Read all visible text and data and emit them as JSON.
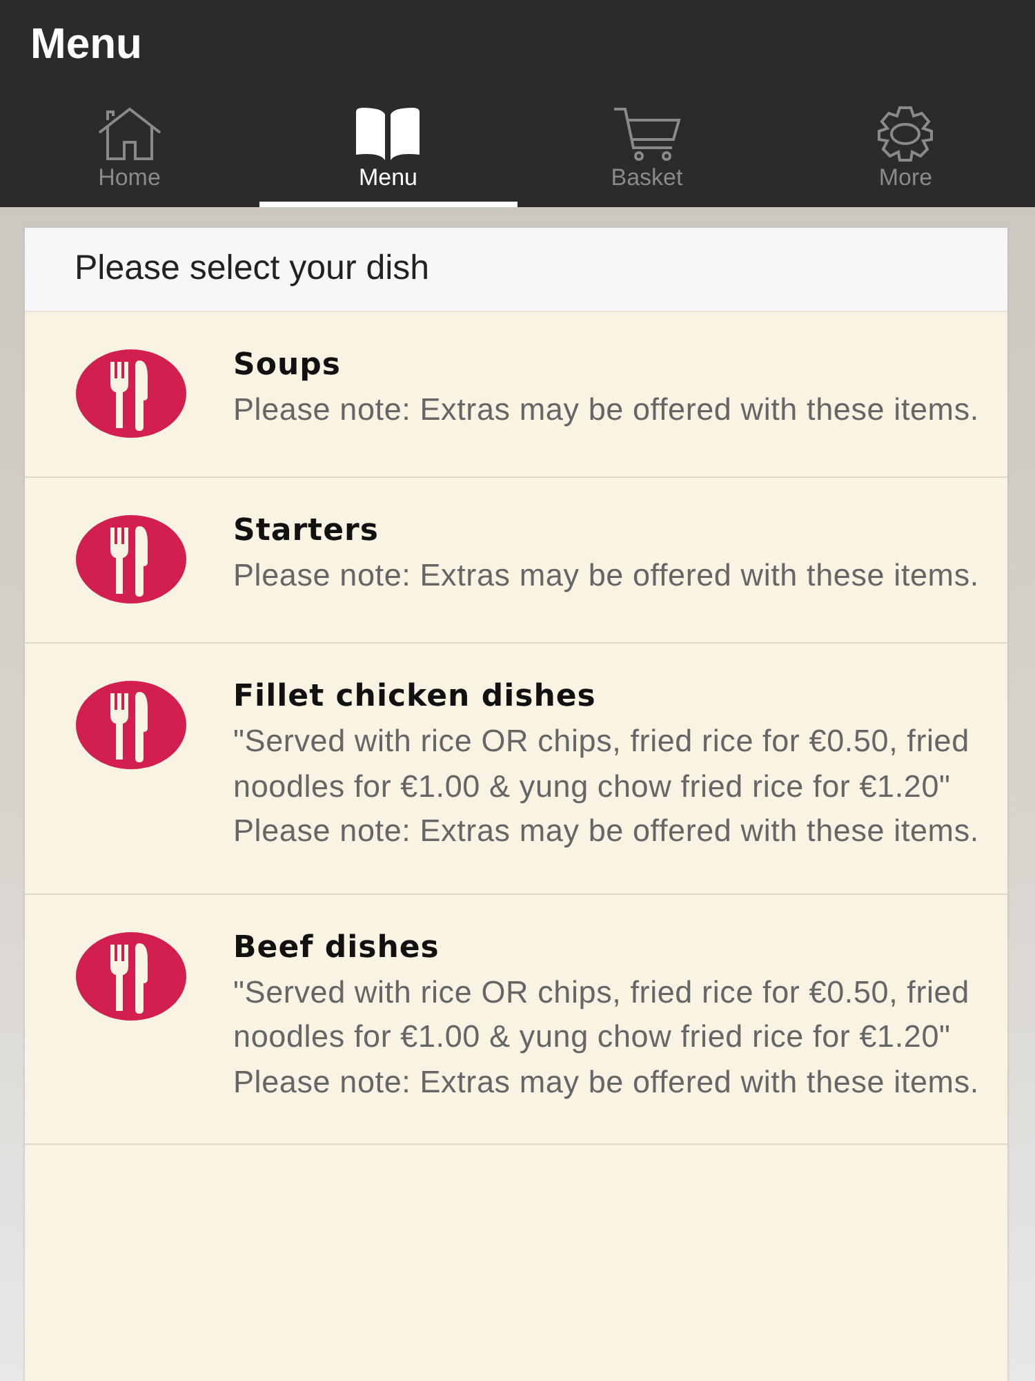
{
  "header": {
    "title": "Menu"
  },
  "tabs": [
    {
      "label": "Home",
      "kind": "home",
      "selected": false
    },
    {
      "label": "Menu",
      "kind": "menu",
      "selected": true
    },
    {
      "label": "Basket",
      "kind": "basket",
      "selected": false
    },
    {
      "label": "More",
      "kind": "more",
      "selected": false
    }
  ],
  "panel": {
    "heading": "Please select your dish",
    "categories": [
      {
        "name": "Soups",
        "note": "Please note: Extras may be offered with these items."
      },
      {
        "name": "Starters",
        "note": "Please note: Extras may be offered with these items."
      },
      {
        "name": "Fillet chicken dishes",
        "note": "\"Served with rice OR chips, fried rice for €0.50, fried noodles for €1.00 & yung chow fried rice for €1.20\" Please note: Extras may be offered with these items."
      },
      {
        "name": "Beef dishes",
        "note": "\"Served with rice OR chips, fried rice for €0.50, fried noodles for €1.00 & yung chow fried rice for €1.20\" Please note: Extras may be offered with these items."
      }
    ]
  }
}
